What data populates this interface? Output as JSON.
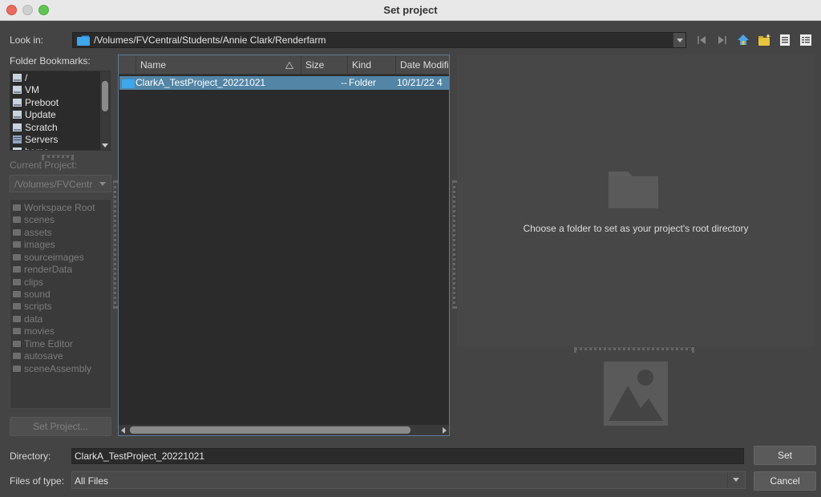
{
  "window": {
    "title": "Set project"
  },
  "lookin": {
    "label": "Look in:",
    "path": "/Volumes/FVCentral/Students/Annie Clark/Renderfarm"
  },
  "toolbar": {
    "icons": [
      "back-icon",
      "forward-icon",
      "home-icon",
      "new-folder-icon",
      "list-view-icon",
      "details-view-icon"
    ]
  },
  "bookmarks": {
    "label": "Folder Bookmarks:",
    "items": [
      {
        "label": "/"
      },
      {
        "label": "VM"
      },
      {
        "label": "Preboot"
      },
      {
        "label": "Update"
      },
      {
        "label": "Scratch"
      },
      {
        "label": "Servers"
      },
      {
        "label": "home"
      }
    ]
  },
  "current_project": {
    "label": "Current Project:",
    "value": "/Volumes/FVCentr"
  },
  "workspace": {
    "items": [
      {
        "label": "Workspace Root"
      },
      {
        "label": "scenes"
      },
      {
        "label": "assets"
      },
      {
        "label": "images"
      },
      {
        "label": "sourceimages"
      },
      {
        "label": "renderData"
      },
      {
        "label": "clips"
      },
      {
        "label": "sound"
      },
      {
        "label": "scripts"
      },
      {
        "label": "data"
      },
      {
        "label": "movies"
      },
      {
        "label": "Time Editor"
      },
      {
        "label": "autosave"
      },
      {
        "label": "sceneAssembly"
      }
    ]
  },
  "set_project_button": "Set Project...",
  "files": {
    "columns": {
      "name": "Name",
      "size": "Size",
      "kind": "Kind",
      "date": "Date Modifi"
    },
    "rows": [
      {
        "name": "ClarkA_TestProject_20221021",
        "size": "--",
        "kind": "Folder",
        "date": "10/21/22 4"
      }
    ]
  },
  "preview": {
    "message": "Choose a folder to set as your project's root directory"
  },
  "directory": {
    "label": "Directory:",
    "value": "ClarkA_TestProject_20221021"
  },
  "filetype": {
    "label": "Files of type:",
    "value": "All Files"
  },
  "buttons": {
    "set": "Set",
    "cancel": "Cancel"
  },
  "colors": {
    "selection": "#5285a6",
    "folder_blue": "#3ea6ea",
    "panel_bg": "#444444",
    "field_bg": "#2b2b2b"
  }
}
